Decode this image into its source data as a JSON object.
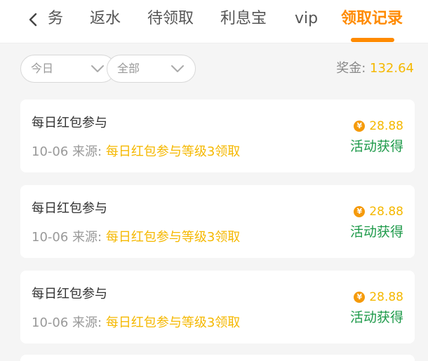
{
  "header": {
    "tabs": [
      {
        "label": "务"
      },
      {
        "label": "返水"
      },
      {
        "label": "待领取"
      },
      {
        "label": "利息宝"
      },
      {
        "label": "vip"
      },
      {
        "label": "领取记录"
      }
    ],
    "active_tab_index": 5
  },
  "filters": {
    "date": {
      "value": "今日"
    },
    "type": {
      "value": "全部"
    }
  },
  "bonus": {
    "label": "奖金:",
    "value": "132.64"
  },
  "records": [
    {
      "title": "每日红包参与",
      "date": "10-06",
      "source_label": "来源:",
      "source": "每日红包参与等级3领取",
      "amount": "28.88",
      "status": "活动获得"
    },
    {
      "title": "每日红包参与",
      "date": "10-06",
      "source_label": "来源:",
      "source": "每日红包参与等级3领取",
      "amount": "28.88",
      "status": "活动获得"
    },
    {
      "title": "每日红包参与",
      "date": "10-06",
      "source_label": "来源:",
      "source": "每日红包参与等级3领取",
      "amount": "28.88",
      "status": "活动获得"
    }
  ],
  "icons": {
    "back": "chevron-left-icon",
    "dropdown": "chevron-down-icon",
    "coin": "yuan-coin-icon"
  },
  "colors": {
    "accent": "#ff8a00",
    "gold": "#f5b800",
    "status_green": "#1e9a4a",
    "background": "#f5f5f5"
  }
}
